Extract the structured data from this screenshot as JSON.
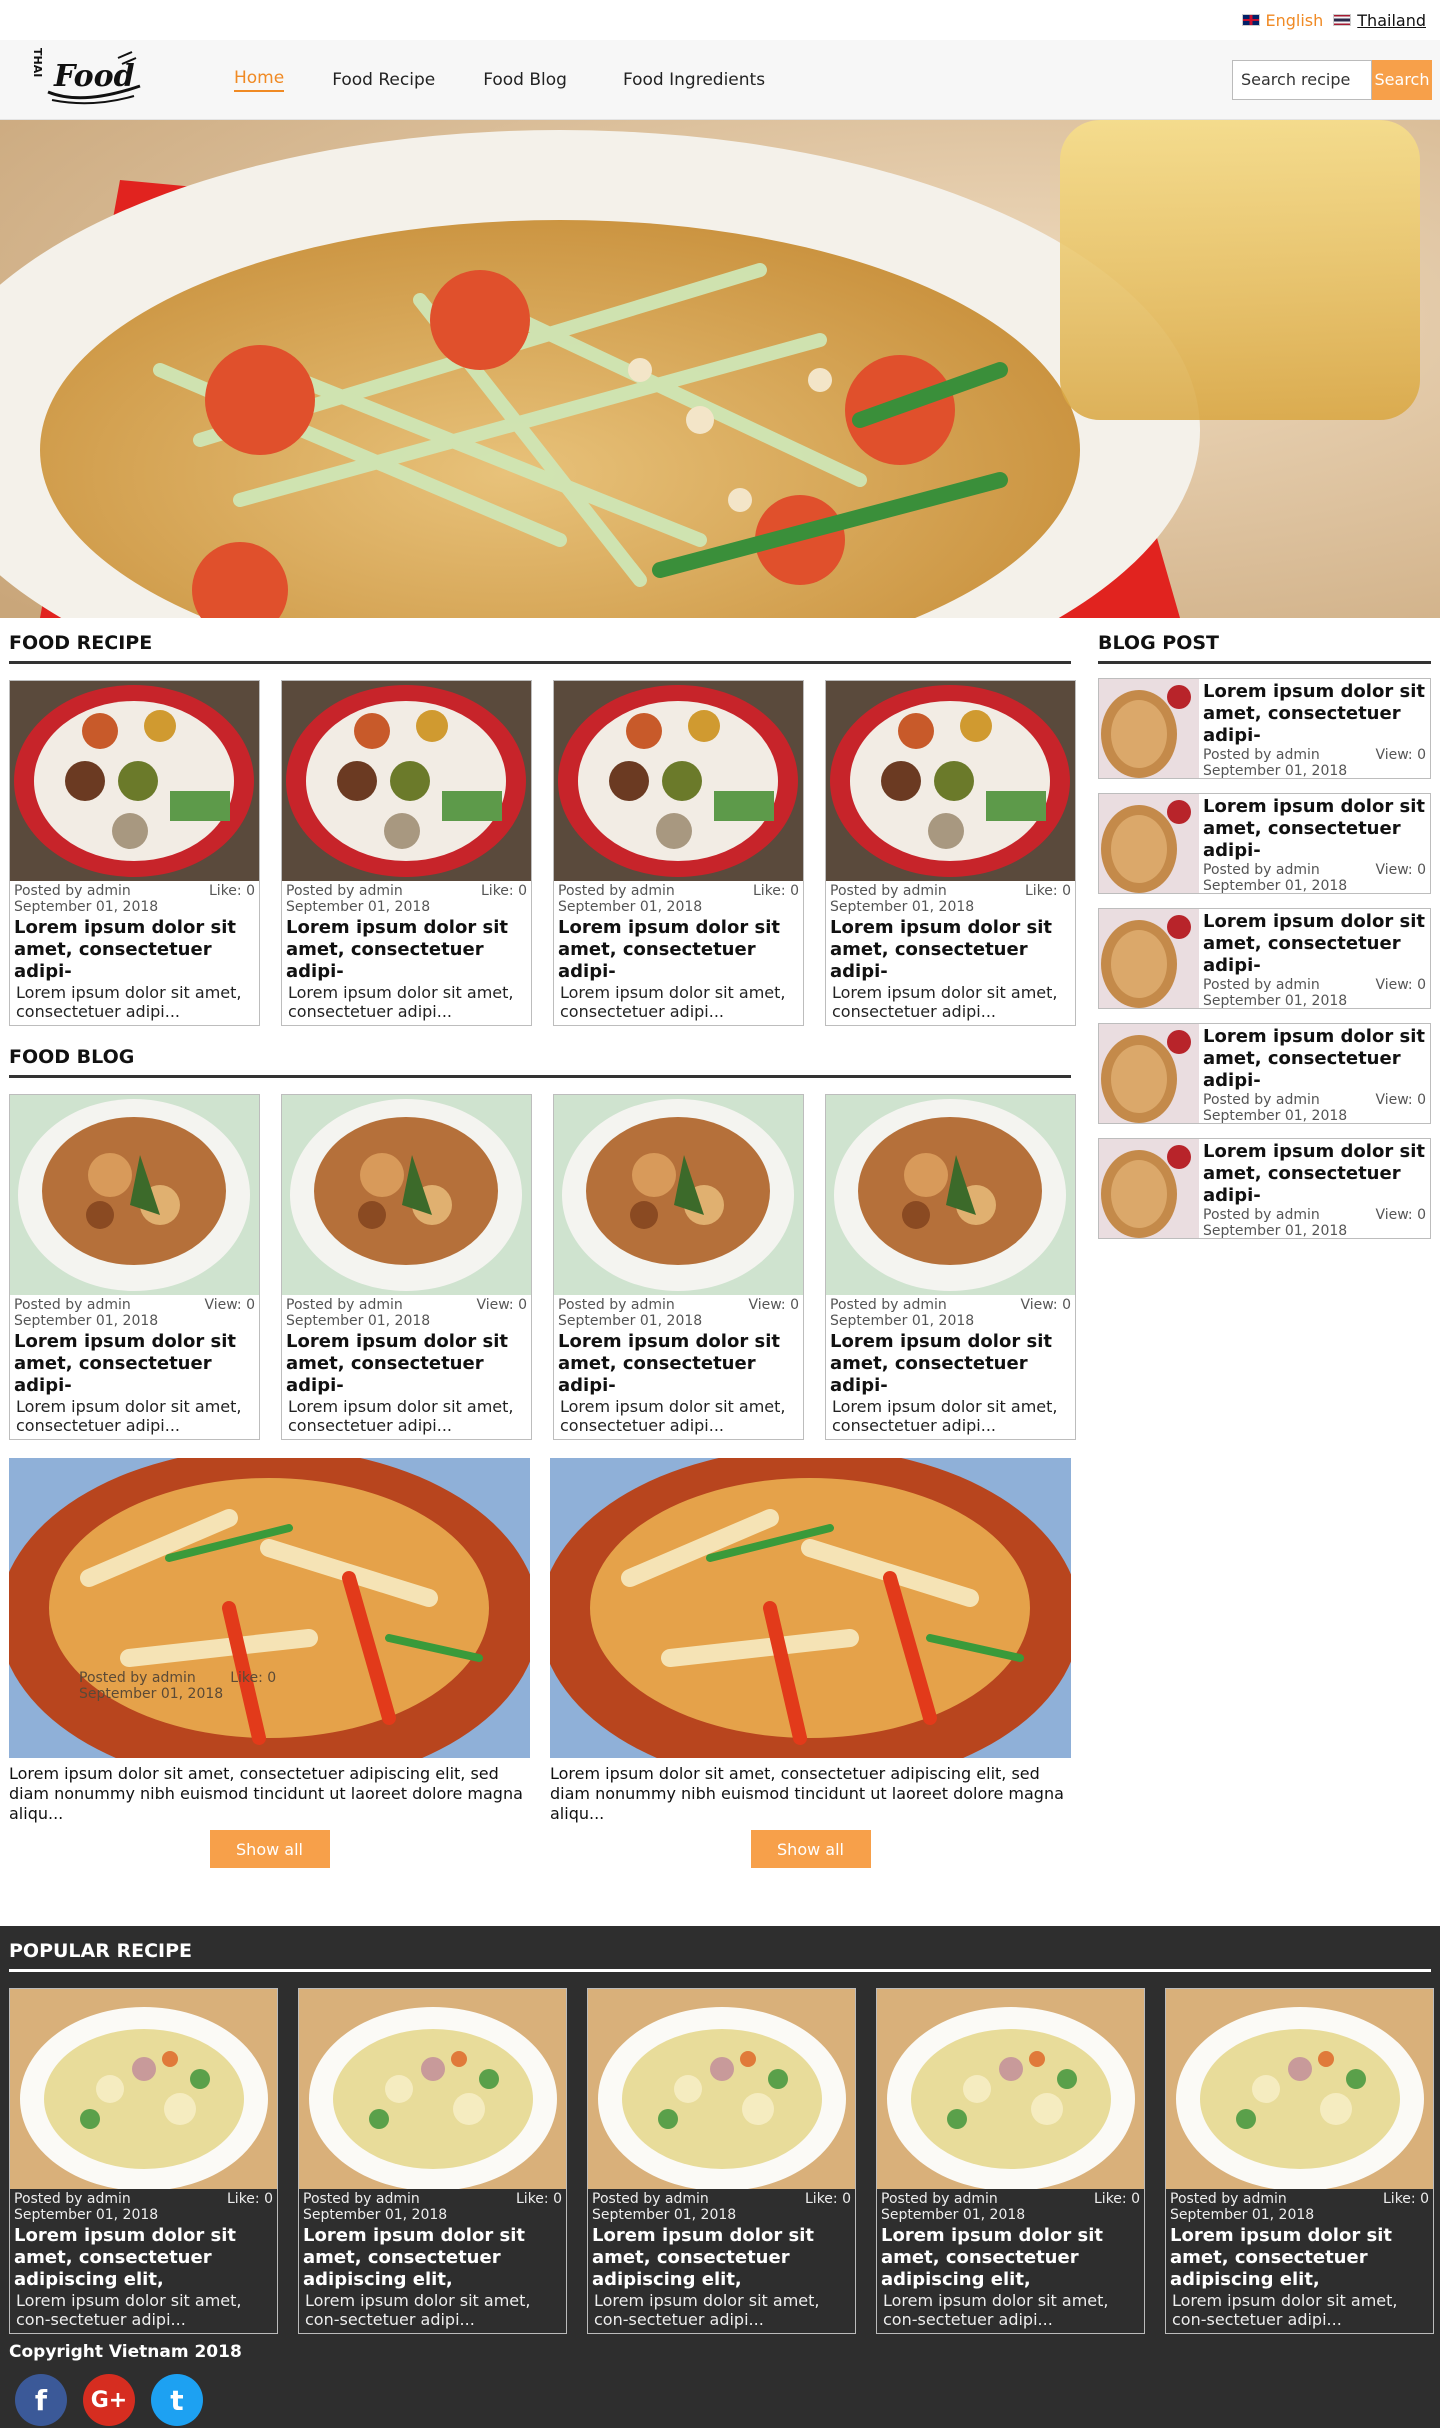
{
  "lang": {
    "english": "English",
    "thailand": "Thailand"
  },
  "logo": {
    "thai": "THAI",
    "food": "Food"
  },
  "nav": [
    {
      "label": "Home",
      "active": true
    },
    {
      "label": "Food Recipe",
      "active": false
    },
    {
      "label": "Food Blog",
      "active": false
    },
    {
      "label": "Food Ingredients",
      "active": false
    }
  ],
  "search": {
    "placeholder": "Search recipe",
    "button": "Search"
  },
  "sections": {
    "food_recipe": "FOOD RECIPE",
    "food_blog": "FOOD BLOG",
    "blog_post": "BLOG POST",
    "popular_recipe": "POPULAR RECIPE"
  },
  "recipe_cards": [
    {
      "posted": "Posted by admin",
      "stat": "Like: 0",
      "date": "September 01, 2018",
      "title": "Lorem ipsum dolor sit amet, consectetuer adipi-",
      "desc": "Lorem ipsum dolor sit amet, consectetuer adipi..."
    },
    {
      "posted": "Posted by admin",
      "stat": "Like: 0",
      "date": "September 01, 2018",
      "title": "Lorem ipsum dolor sit amet, consectetuer adipi-",
      "desc": "Lorem ipsum dolor sit amet, consectetuer adipi..."
    },
    {
      "posted": "Posted by admin",
      "stat": "Like: 0",
      "date": "September 01, 2018",
      "title": "Lorem ipsum dolor sit amet, consectetuer adipi-",
      "desc": "Lorem ipsum dolor sit amet, consectetuer adipi..."
    },
    {
      "posted": "Posted by admin",
      "stat": "Like: 0",
      "date": "September 01, 2018",
      "title": "Lorem ipsum dolor sit amet, consectetuer adipi-",
      "desc": "Lorem ipsum dolor sit amet, consectetuer adipi..."
    }
  ],
  "blog_cards": [
    {
      "posted": "Posted by admin",
      "stat": "View: 0",
      "date": "September 01, 2018",
      "title": "Lorem ipsum dolor sit amet, consectetuer adipi-",
      "desc": "Lorem ipsum dolor sit amet, consectetuer adipi..."
    },
    {
      "posted": "Posted by admin",
      "stat": "View: 0",
      "date": "September 01, 2018",
      "title": "Lorem ipsum dolor sit amet, consectetuer adipi-",
      "desc": "Lorem ipsum dolor sit amet, consectetuer adipi..."
    },
    {
      "posted": "Posted by admin",
      "stat": "View: 0",
      "date": "September 01, 2018",
      "title": "Lorem ipsum dolor sit amet, consectetuer adipi-",
      "desc": "Lorem ipsum dolor sit amet, consectetuer adipi..."
    },
    {
      "posted": "Posted by admin",
      "stat": "View: 0",
      "date": "September 01, 2018",
      "title": "Lorem ipsum dolor sit amet, consectetuer adipi-",
      "desc": "Lorem ipsum dolor sit amet, consectetuer adipi..."
    }
  ],
  "wide_cards": [
    {
      "overlay_posted": "Posted by admin",
      "overlay_date": "September 01, 2018",
      "overlay_stat": "Like: 0",
      "desc": "Lorem ipsum dolor sit amet, consectetuer adipiscing elit, sed diam nonummy nibh euismod tincidunt ut laoreet dolore magna aliqu...",
      "button": "Show all"
    },
    {
      "desc": "Lorem ipsum dolor sit amet, consectetuer adipiscing elit, sed diam nonummy nibh euismod tincidunt ut laoreet dolore magna aliqu...",
      "button": "Show all"
    }
  ],
  "blog_posts": [
    {
      "title": "Lorem ipsum dolor sit amet, consectetuer adipi-",
      "posted": "Posted by admin",
      "stat": "View: 0",
      "date": "September 01, 2018"
    },
    {
      "title": "Lorem ipsum dolor sit amet, consectetuer adipi-",
      "posted": "Posted by admin",
      "stat": "View: 0",
      "date": "September 01, 2018"
    },
    {
      "title": "Lorem ipsum dolor sit amet, consectetuer adipi-",
      "posted": "Posted by admin",
      "stat": "View: 0",
      "date": "September 01, 2018"
    },
    {
      "title": "Lorem ipsum dolor sit amet, consectetuer adipi-",
      "posted": "Posted by admin",
      "stat": "View: 0",
      "date": "September 01, 2018"
    },
    {
      "title": "Lorem ipsum dolor sit amet, consectetuer adipi-",
      "posted": "Posted by admin",
      "stat": "View: 0",
      "date": "September 01, 2018"
    }
  ],
  "popular_cards": [
    {
      "posted": "Posted by admin",
      "stat": "Like: 0",
      "date": "September 01, 2018",
      "title": "Lorem ipsum dolor sit amet, consectetuer adipiscing elit,",
      "desc": "Lorem ipsum dolor sit amet, con-sectetuer adipi..."
    },
    {
      "posted": "Posted by admin",
      "stat": "Like: 0",
      "date": "September 01, 2018",
      "title": "Lorem ipsum dolor sit amet, consectetuer adipiscing elit,",
      "desc": "Lorem ipsum dolor sit amet, con-sectetuer adipi..."
    },
    {
      "posted": "Posted by admin",
      "stat": "Like: 0",
      "date": "September 01, 2018",
      "title": "Lorem ipsum dolor sit amet, consectetuer adipiscing elit,",
      "desc": "Lorem ipsum dolor sit amet, con-sectetuer adipi..."
    },
    {
      "posted": "Posted by admin",
      "stat": "Like: 0",
      "date": "September 01, 2018",
      "title": "Lorem ipsum dolor sit amet, consectetuer adipiscing elit,",
      "desc": "Lorem ipsum dolor sit amet, con-sectetuer adipi..."
    },
    {
      "posted": "Posted by admin",
      "stat": "Like: 0",
      "date": "September 01, 2018",
      "title": "Lorem ipsum dolor sit amet, consectetuer adipiscing elit,",
      "desc": "Lorem ipsum dolor sit amet, con-sectetuer adipi..."
    }
  ],
  "footer": {
    "copyright": "Copyright Vietnam 2018",
    "social": [
      {
        "icon": "facebook-icon",
        "glyph": "f"
      },
      {
        "icon": "google-plus-icon",
        "glyph": "G+"
      },
      {
        "icon": "twitter-icon",
        "glyph": "t"
      }
    ]
  },
  "colors": {
    "accent": "#f08a24",
    "button": "#f7a04a",
    "footer_bg": "#2e2e2e"
  }
}
